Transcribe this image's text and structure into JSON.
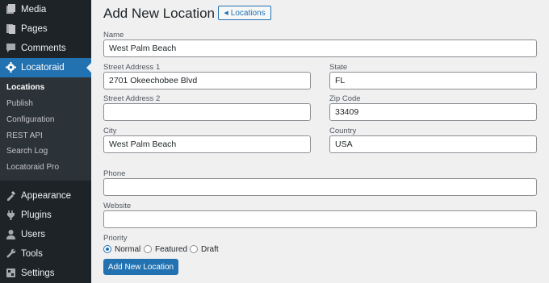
{
  "sidebar": {
    "menu": [
      {
        "label": "Media",
        "icon": "media-icon"
      },
      {
        "label": "Pages",
        "icon": "pages-icon"
      },
      {
        "label": "Comments",
        "icon": "comments-icon"
      },
      {
        "label": "Locatoraid",
        "icon": "gear-icon",
        "active": true
      },
      {
        "label": "Appearance",
        "icon": "appearance-icon"
      },
      {
        "label": "Plugins",
        "icon": "plugins-icon"
      },
      {
        "label": "Users",
        "icon": "users-icon"
      },
      {
        "label": "Tools",
        "icon": "tools-icon"
      },
      {
        "label": "Settings",
        "icon": "settings-icon"
      }
    ],
    "submenu": [
      {
        "label": "Locations",
        "current": true
      },
      {
        "label": "Publish"
      },
      {
        "label": "Configuration"
      },
      {
        "label": "REST API"
      },
      {
        "label": "Search Log"
      },
      {
        "label": "Locatoraid Pro"
      }
    ]
  },
  "header": {
    "title": "Add New Location",
    "back_button": "Locations",
    "back_icon": "chevron-left-icon"
  },
  "form": {
    "name": {
      "label": "Name",
      "value": "West Palm Beach"
    },
    "street1": {
      "label": "Street Address 1",
      "value": "2701 Okeechobee Blvd"
    },
    "state": {
      "label": "State",
      "value": "FL"
    },
    "street2": {
      "label": "Street Address 2",
      "value": ""
    },
    "zip": {
      "label": "Zip Code",
      "value": "33409"
    },
    "city": {
      "label": "City",
      "value": "West Palm Beach"
    },
    "country": {
      "label": "Country",
      "value": "USA"
    },
    "phone": {
      "label": "Phone",
      "value": ""
    },
    "website": {
      "label": "Website",
      "value": ""
    },
    "priority": {
      "label": "Priority",
      "selected": "Normal",
      "options": [
        "Normal",
        "Featured",
        "Draft"
      ]
    },
    "submit_label": "Add New Location"
  },
  "colors": {
    "sidebar_bg": "#1d2327",
    "accent": "#2271b1",
    "page_bg": "#f0f0f1"
  }
}
